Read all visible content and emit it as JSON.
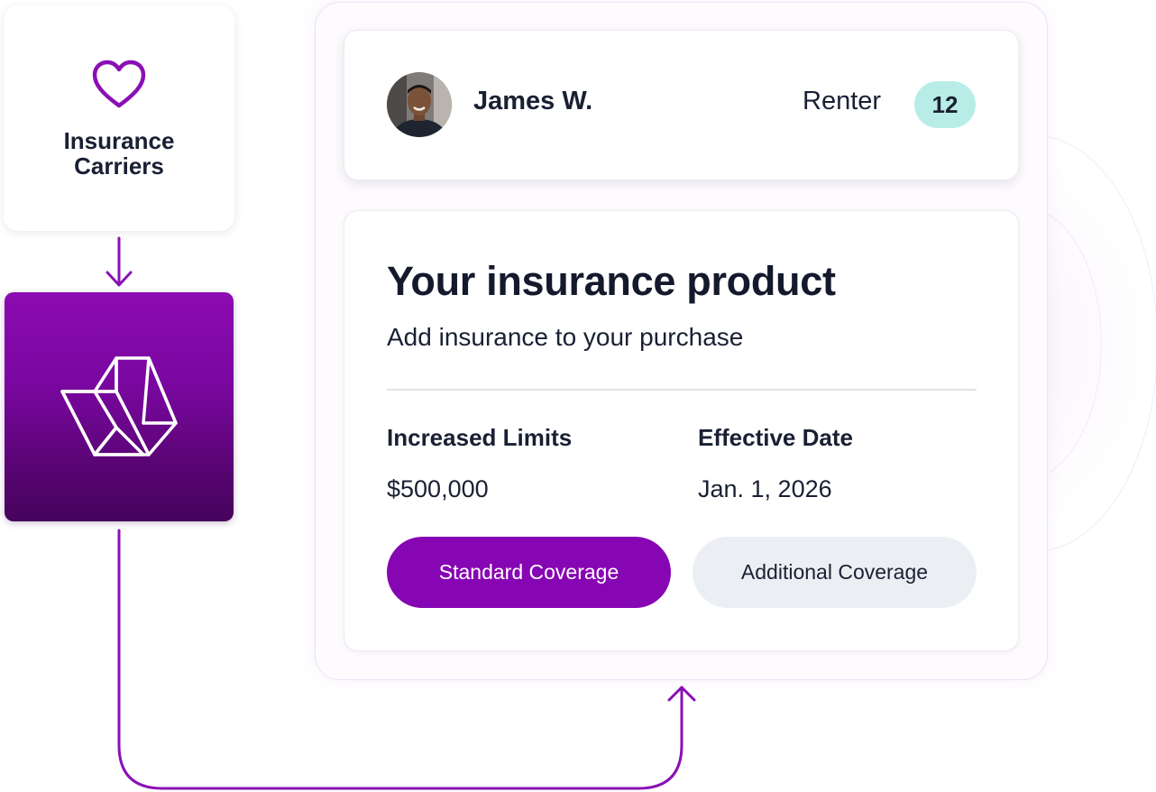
{
  "carrier_card": {
    "label": "Insurance Carriers"
  },
  "user": {
    "name": "James W.",
    "role": "Renter",
    "badge": "12"
  },
  "product": {
    "title": "Your insurance product",
    "subtitle": "Add insurance to your purchase",
    "limits_label": "Increased Limits",
    "limits_value": "$500,000",
    "date_label": "Effective Date",
    "date_value": "Jan. 1, 2026",
    "primary_button": "Standard Coverage",
    "secondary_button": "Additional Coverage"
  },
  "colors": {
    "brand_purple": "#8706b3",
    "badge_teal": "#b8ede7",
    "secondary_button": "#ebeef3",
    "text_dark": "#1a2033"
  },
  "icons": {
    "heart": "heart-icon",
    "logo": "isometric-logo-icon",
    "avatar": "user-avatar-photo",
    "down_arrow": "arrow-down-icon",
    "up_arrow": "arrow-up-icon"
  }
}
